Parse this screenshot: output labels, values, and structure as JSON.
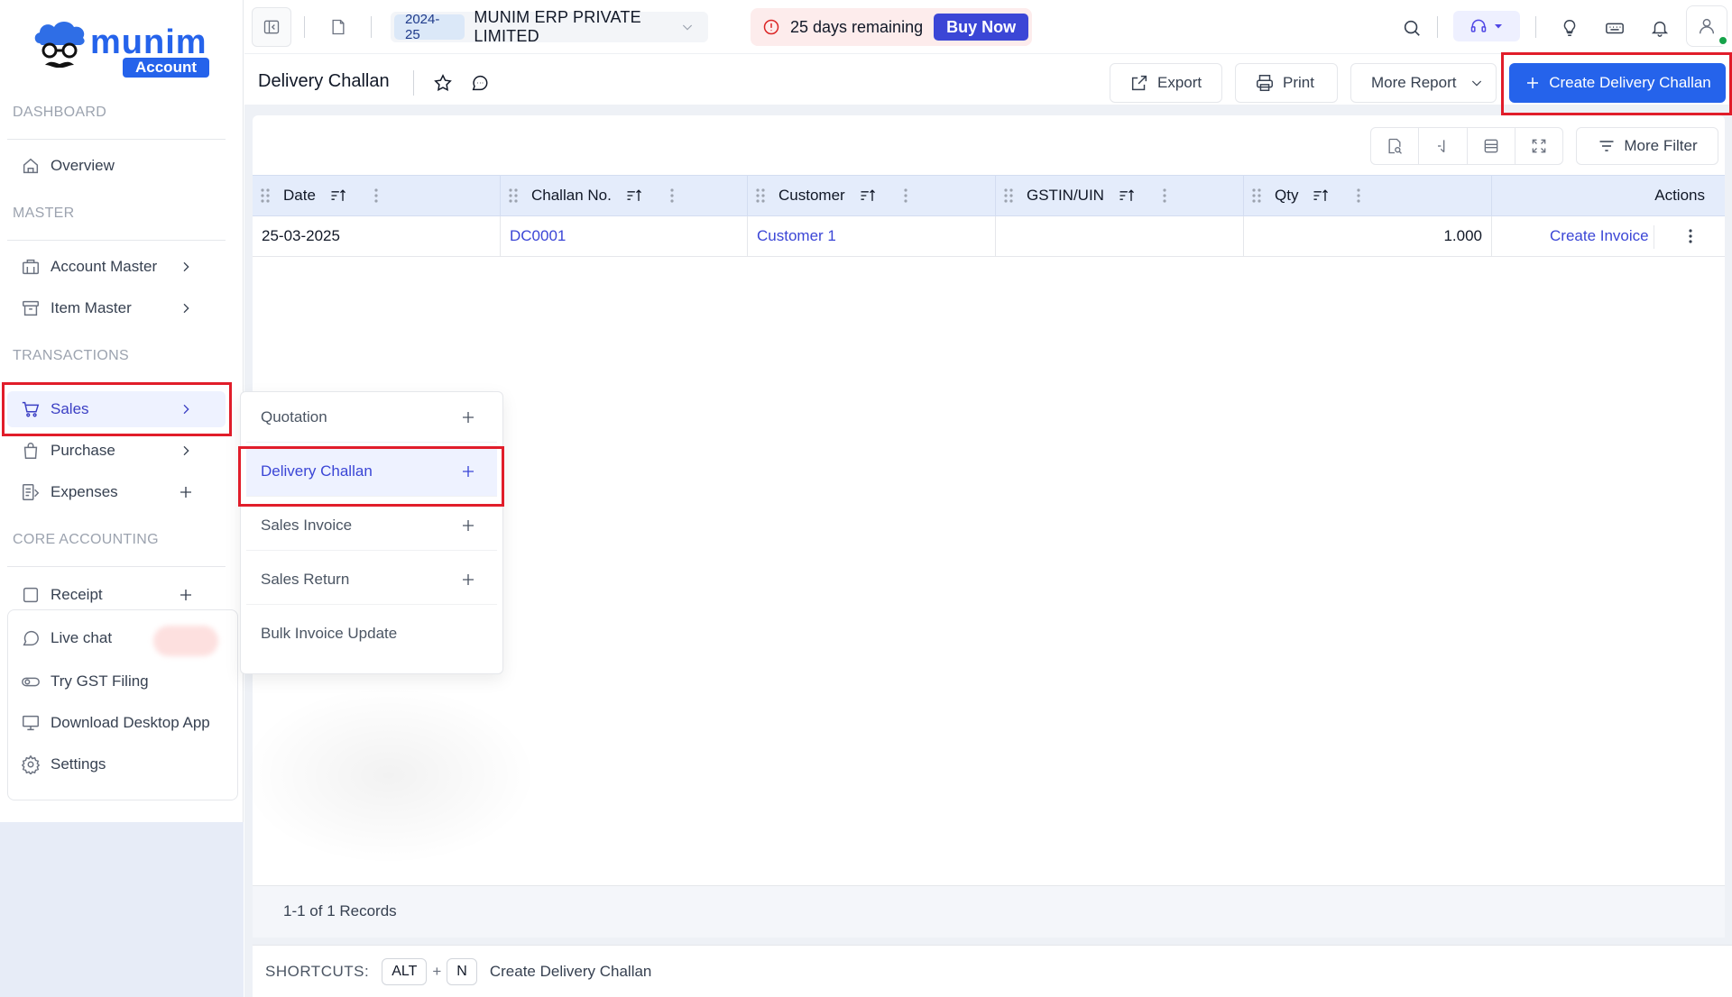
{
  "brand": {
    "word": "munim",
    "badge": "Account"
  },
  "sidebar": {
    "sections": {
      "dashboard": "DASHBOARD",
      "master": "MASTER",
      "transactions": "TRANSACTIONS",
      "core_accounting": "CORE ACCOUNTING"
    },
    "items": {
      "overview": "Overview",
      "account_master": "Account Master",
      "item_master": "Item Master",
      "sales": "Sales",
      "purchase": "Purchase",
      "expenses": "Expenses",
      "receipt": "Receipt",
      "live_chat": "Live chat",
      "gst_filing": "Try GST Filing",
      "desktop_app": "Download Desktop App",
      "settings": "Settings"
    },
    "active_item": "Sales"
  },
  "topbar": {
    "financial_year": "2024-25",
    "company": "MUNIM ERP PRIVATE LIMITED",
    "trial_text": "25 days remaining",
    "buy_now": "Buy Now"
  },
  "page": {
    "title": "Delivery Challan",
    "export": "Export",
    "print": "Print",
    "more_report": "More Report",
    "create": "Create Delivery Challan",
    "more_filter": "More Filter"
  },
  "table": {
    "columns": [
      "Date",
      "Challan No.",
      "Customer",
      "GSTIN/UIN",
      "Qty",
      "Actions"
    ],
    "rows": [
      {
        "date": "25-03-2025",
        "challan_no": "DC0001",
        "customer": "Customer 1",
        "gstin": "",
        "qty": "1.000",
        "action": "Create Invoice"
      }
    ],
    "records": "1-1 of 1 Records"
  },
  "shortcuts": {
    "label": "SHORTCUTS:",
    "key1": "ALT",
    "plus": "+",
    "key2": "N",
    "action": "Create Delivery Challan"
  },
  "submenu": {
    "items": [
      "Quotation",
      "Delivery Challan",
      "Sales Invoice",
      "Sales Return",
      "Bulk Invoice Update"
    ],
    "active": "Delivery Challan"
  },
  "colors": {
    "accent": "#2563eb",
    "active_nav": "#3b3fc4",
    "highlight_box": "#e11d2a",
    "trial_bg": "#fdecec"
  }
}
